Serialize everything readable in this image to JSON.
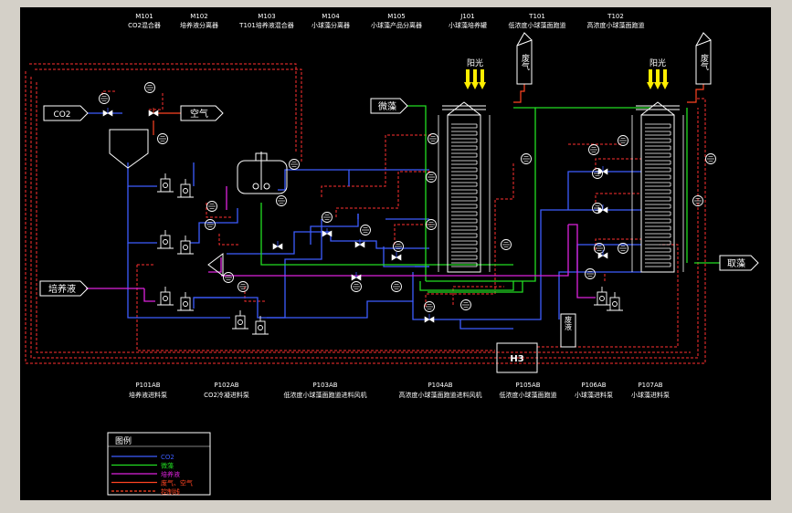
{
  "header_equipment": [
    {
      "tag": "M101",
      "name": "CO2混合器"
    },
    {
      "tag": "M102",
      "name": "培养液分离器"
    },
    {
      "tag": "M103",
      "name": "T101培养液混合器"
    },
    {
      "tag": "M104",
      "name": "小球藻分离器"
    },
    {
      "tag": "M105",
      "name": "小球藻产品分离器"
    },
    {
      "tag": "J101",
      "name": "小球藻培养罐"
    },
    {
      "tag": "T101",
      "name": "低浓度小球藻面跑道"
    },
    {
      "tag": "T102",
      "name": "高浓度小球藻面跑道"
    }
  ],
  "footer_pumps": [
    {
      "tag": "P101AB",
      "name": "培养液进料泵"
    },
    {
      "tag": "P102AB",
      "name": "CO2冷凝进料泵"
    },
    {
      "tag": "P103AB",
      "name": "低浓度小球藻面跑道进料风机"
    },
    {
      "tag": "P104AB",
      "name": "高浓度小球藻面跑道进料风机"
    },
    {
      "tag": "P105AB",
      "name": "低浓度小球藻面跑道"
    },
    {
      "tag": "P106AB",
      "name": "小球藻进料泵"
    },
    {
      "tag": "P107AB",
      "name": "小球藻进料泵"
    }
  ],
  "boxes": {
    "co2": "CO2",
    "air": "空气",
    "microalgae": "微藻",
    "culture": "培养液",
    "waste_gas_1": "废气",
    "waste_gas_2": "废气",
    "waste_liquid": "废液",
    "product": "取藻",
    "sunlight_1": "阳光",
    "sunlight_2": "阳光",
    "controller": "H3"
  },
  "legend": {
    "title": "图例",
    "items": [
      {
        "label": "CO2",
        "color": "#3c5cff"
      },
      {
        "label": "微藻",
        "color": "#22dd22"
      },
      {
        "label": "培养液",
        "color": "#dd22dd"
      },
      {
        "label": "废气、空气",
        "color": "#ff4422"
      },
      {
        "label": "控制线",
        "color": "#ff4422"
      }
    ]
  },
  "colors": {
    "co2": "#3c5cff",
    "algae": "#22dd22",
    "culture": "#dd22dd",
    "gas": "#ff4422",
    "control": "#ff3030",
    "equipment": "#ffffff",
    "sun": "#ffee00"
  }
}
